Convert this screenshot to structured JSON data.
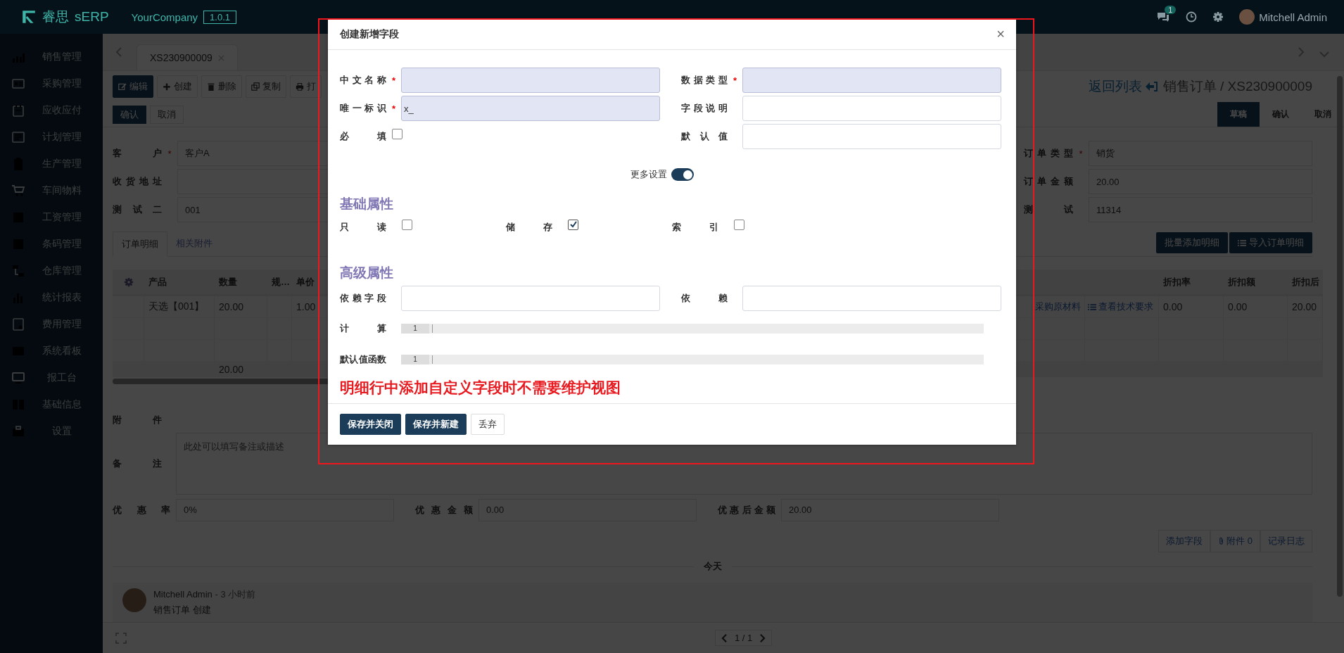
{
  "topbar": {
    "brand": "睿思",
    "product": "sERP",
    "company": "YourCompany",
    "version": "1.0.1",
    "unread_count": "1",
    "user": "Mitchell Admin"
  },
  "sidebar": {
    "items": [
      {
        "label": "销售管理"
      },
      {
        "label": "采购管理"
      },
      {
        "label": "应收应付"
      },
      {
        "label": "计划管理"
      },
      {
        "label": "生产管理"
      },
      {
        "label": "车间物料"
      },
      {
        "label": "工资管理"
      },
      {
        "label": "条码管理"
      },
      {
        "label": "仓库管理"
      },
      {
        "label": "统计报表"
      },
      {
        "label": "费用管理"
      },
      {
        "label": "系统看板"
      },
      {
        "label": "报工台"
      },
      {
        "label": "基础信息"
      },
      {
        "label": "设置"
      }
    ]
  },
  "record_tabs": [
    {
      "label": "XS230900009"
    }
  ],
  "toolbar": {
    "buttons": [
      {
        "label": "编辑",
        "selected": true
      },
      {
        "label": "创建",
        "selected": false
      },
      {
        "label": "删除",
        "selected": false
      },
      {
        "label": "复制",
        "selected": false
      },
      {
        "label": "打",
        "selected": false
      }
    ]
  },
  "breadcrumb": {
    "back": "返回列表",
    "title": "销售订单 / XS230900009"
  },
  "actions": [
    {
      "label": "确认",
      "primary": true
    },
    {
      "label": "取消",
      "primary": false
    }
  ],
  "status_steps": [
    {
      "label": "草稿",
      "selected": true
    },
    {
      "label": "确认",
      "selected": false
    },
    {
      "label": "取消",
      "selected": false
    }
  ],
  "form": {
    "left": [
      {
        "label": "客户",
        "required_mark": "*",
        "value": "客户A"
      },
      {
        "label": "收货地址"
      },
      {
        "label": "测试二",
        "value": "001"
      }
    ],
    "right": [
      {
        "label": "订单类型",
        "required_mark": "*",
        "value": "销货"
      },
      {
        "label": "订单金额",
        "value": "20.00"
      },
      {
        "label": "测试",
        "value": "11314"
      }
    ]
  },
  "notebook": {
    "tabs": [
      {
        "label": "订单明细",
        "selected": true
      },
      {
        "label": "相关附件",
        "selected": false
      }
    ],
    "buttons": [
      "批量添加明细",
      "导入订单明细"
    ]
  },
  "lines": {
    "columns": [
      "产品",
      "数量",
      "规…",
      "单价"
    ],
    "right_columns": [
      "折扣率",
      "折扣额",
      "折扣后"
    ],
    "rows": [
      {
        "product": "天选【001】",
        "quantity": "20.00",
        "price": "1.00",
        "links": [
          "采购原材料",
          "查看技术要求"
        ],
        "discount_rate": "0.00",
        "discount_amount": "0.00",
        "after_discount": "20.00"
      }
    ],
    "total_quantity": "20.00"
  },
  "attachments_label": "附件",
  "note": {
    "label": "备注",
    "placeholder": "此处可以填写备注或描述"
  },
  "discounts": [
    {
      "label": "优惠率",
      "value": "0%"
    },
    {
      "label": "优惠金额",
      "value": "0.00"
    },
    {
      "label": "优惠后金额",
      "value": "20.00"
    }
  ],
  "chatter": {
    "buttons": [
      "添加字段",
      "附件 0",
      "记录日志"
    ],
    "day": "今天",
    "messages": [
      {
        "author": "Mitchell Admin",
        "time": "- 3 小时前",
        "body": "销售订单 创建"
      }
    ]
  },
  "pager": "1 / 1",
  "dialog": {
    "title": "创建新增字段",
    "close": "×",
    "left": [
      {
        "label": "中文名称",
        "kind": "text",
        "required": true,
        "required_mark": "*"
      },
      {
        "label": "唯一标识",
        "kind": "text",
        "required": true,
        "required_mark": "*",
        "value": "x_"
      },
      {
        "label": "必填",
        "kind": "checkbox",
        "checked": false
      }
    ],
    "right": [
      {
        "label": "数据类型",
        "kind": "text",
        "required": true,
        "required_mark": "*"
      },
      {
        "label": "字段说明",
        "kind": "text",
        "required": false
      },
      {
        "label": "默认值",
        "kind": "text",
        "required": false
      }
    ],
    "more_settings": {
      "label": "更多设置",
      "on": true
    },
    "basic": {
      "title": "基础属性",
      "items": [
        {
          "label": "只读",
          "checked": false
        },
        {
          "label": "储存",
          "checked": true
        },
        {
          "label": "索引",
          "checked": false
        }
      ]
    },
    "advanced": {
      "title": "高级属性",
      "inputs": [
        {
          "label": "依赖字段"
        },
        {
          "label": "依赖"
        }
      ],
      "code_fields": [
        {
          "label": "计算",
          "line_number": "1"
        },
        {
          "label": "默认值函数",
          "line_number": "1"
        }
      ]
    },
    "note": "明细行中添加自定义字段时不需要维护视图",
    "buttons": [
      {
        "label": "保存并关闭",
        "primary": true
      },
      {
        "label": "保存并新建",
        "primary": true
      },
      {
        "label": "丢弃",
        "primary": false
      }
    ]
  }
}
